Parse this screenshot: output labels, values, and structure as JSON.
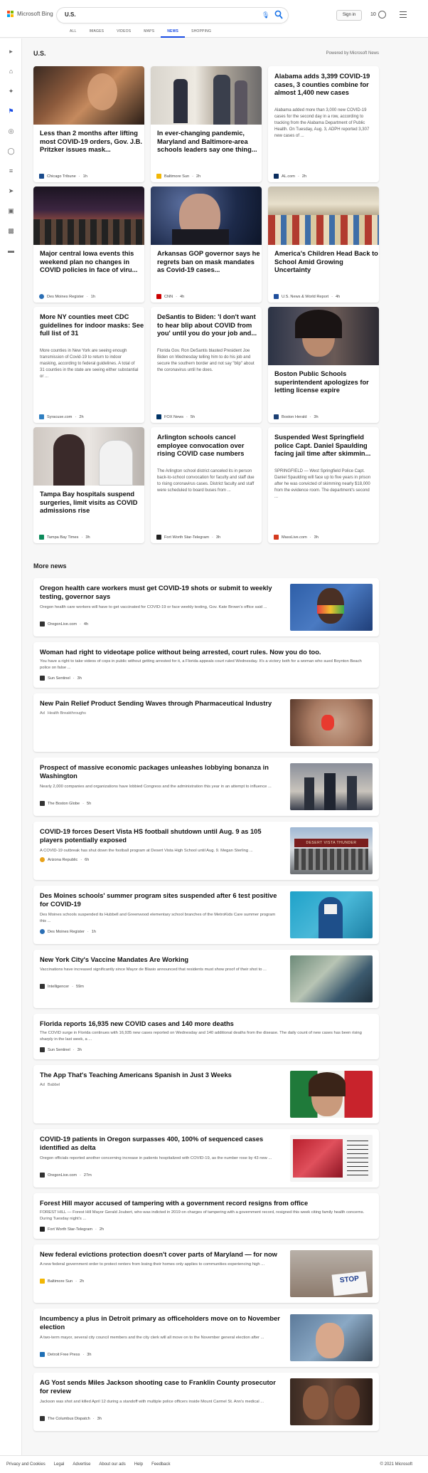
{
  "header": {
    "logo_text": "Microsoft Bing",
    "search_value": "U.S.",
    "signin": "Sign in",
    "rewards_points": "10",
    "tabs": [
      "ALL",
      "IMAGES",
      "VIDEOS",
      "MAPS",
      "NEWS",
      "SHOPPING"
    ],
    "active_tab": "NEWS"
  },
  "section": {
    "title": "U.S.",
    "powered_by": "Powered by Microsoft News"
  },
  "top_cards": [
    {
      "title": "Less than 2 months after lifting most COVID-19 orders, Gov. J.B. Pritzker issues mask...",
      "snippet": "",
      "source": "Chicago Tribune",
      "time": "1h",
      "logo_color": "#1a4b8c"
    },
    {
      "title": "In ever-changing pandemic, Maryland and Baltimore-area schools leaders say one thing...",
      "snippet": "",
      "source": "Baltimore Sun",
      "time": "2h",
      "logo_color": "#f2b705"
    },
    {
      "title": "Alabama adds 3,399 COVID-19 cases, 3 counties combine for almost 1,400 new cases",
      "snippet": "Alabama added more than 3,000 new COVID-19 cases for the second day in a row, according to tracking from the Alabama Department of Public Health. On Tuesday, Aug. 3, ADPH reported 3,307 new cases of ...",
      "source": "AL.com",
      "time": "2h",
      "logo_color": "#0a2d5e"
    },
    {
      "title": "Major central Iowa events this weekend plan no changes in COVID policies in face of viru...",
      "snippet": "",
      "source": "Des Moines Register",
      "time": "1h",
      "logo_color": "#2b6fb5"
    },
    {
      "title": "Arkansas GOP governor says he regrets ban on mask mandates as Covid-19 cases...",
      "snippet": "",
      "source": "CNN",
      "time": "4h",
      "logo_color": "#cc0000"
    },
    {
      "title": "America's Children Head Back to School Amid Growing Uncertainty",
      "snippet": "",
      "source": "U.S. News & World Report",
      "time": "4h",
      "logo_color": "#1f4e9c"
    },
    {
      "title": "More NY counties meet CDC guidelines for indoor masks: See full list of 31",
      "snippet": "More counties in New York are seeing enough transmission of Covid-19 to return to indoor masking, according to federal guidelines. A total of 31 counties in the state are seeing either substantial or ...",
      "source": "Syracuse.com",
      "time": "2h",
      "logo_color": "#2f7fc1"
    },
    {
      "title": "DeSantis to Biden: 'I don't want to hear blip about COVID from you' until you do your job and...",
      "snippet": "Florida Gov. Ron DeSantis blasted President Joe Biden on Wednesday telling him to do his job and secure the southern border and not say \"blip\" about the coronavirus until he does.",
      "source": "FOX News",
      "time": "5h",
      "logo_color": "#003366"
    },
    {
      "title": "Boston Public Schools superintendent apologizes for letting license expire",
      "snippet": "",
      "source": "Boston Herald",
      "time": "3h",
      "logo_color": "#1b3f73"
    },
    {
      "title": "Tampa Bay hospitals suspend surgeries, limit visits as COVID admissions rise",
      "snippet": "",
      "source": "Tampa Bay Times",
      "time": "3h",
      "logo_color": "#0c8a5b"
    },
    {
      "title": "Arlington schools cancel employee convocation over rising COVID case numbers",
      "snippet": "The Arlington school district canceled its in person back-to-school convocation for faculty and staff due to rising coronavirus cases. District faculty and staff were scheduled to board buses from ...",
      "source": "Fort Worth Star-Telegram",
      "time": "3h",
      "logo_color": "#222222"
    },
    {
      "title": "Suspended West Springfield police Capt. Daniel Spaulding facing jail time after skimmin...",
      "snippet": "SPRINGFIELD — West Springfield Police Capt. Daniel Spaulding will face up to five years in prison after he was convicted of skimming nearly $18,000 from the evidence room. The department's second ...",
      "source": "MassLive.com",
      "time": "3h",
      "logo_color": "#d43a1f"
    }
  ],
  "more_news_title": "More news",
  "more_news": [
    {
      "title": "Oregon health care workers must get COVID-19 shots or submit to weekly testing, governor says",
      "snippet": "Oregon health care workers will have to get vaccinated for COVID-19 or face weekly testing, Gov. Kate Brown's office said ...",
      "source": "OregonLive.com",
      "time": "4h",
      "ad": "",
      "logo_color": "#333333"
    },
    {
      "title": "Woman had right to videotape police without being arrested, court rules. Now you do too.",
      "snippet": "You have a right to take videos of cops in public without getting arrested for it, a Florida appeals court ruled Wednesday. It's a victory both for a woman who sued Boynton Beach police on false ...",
      "source": "Sun Sentinel",
      "time": "3h",
      "ad": "",
      "logo_color": "#333333"
    },
    {
      "title": "New Pain Relief Product Sending Waves through Pharmaceutical Industry",
      "snippet": "",
      "source": "Health Breakthroughs",
      "time": "",
      "ad": "Ad",
      "logo_color": ""
    },
    {
      "title": "Prospect of massive economic packages unleashes lobbying bonanza in Washington",
      "snippet": "Nearly 2,000 companies and organizations have lobbied Congress and the administration this year in an attempt to influence ...",
      "source": "The Boston Globe",
      "time": "5h",
      "ad": "",
      "logo_color": "#333333"
    },
    {
      "title": "COVID-19 forces Desert Vista HS football shutdown until Aug. 9 as 105 players potentially exposed",
      "snippet": "A COVID-19 outbreak has shut down the football program at Desert Vista High School until Aug. 9. Megan Sterling ...",
      "source": "Arizona Republic",
      "time": "6h",
      "ad": "",
      "logo_color": "#e8a21b"
    },
    {
      "title": "Des Moines schools' summer program sites suspended after 6 test positive for COVID-19",
      "snippet": "Des Moines schools suspended its Hubbell and Greenwood elementary school branches of the MetroKids Care summer program this ...",
      "source": "Des Moines Register",
      "time": "1h",
      "ad": "",
      "logo_color": "#2b6fb5"
    },
    {
      "title": "New York City's Vaccine Mandates Are Working",
      "snippet": "Vaccinations have increased significantly since Mayor de Blasio announced that residents must show proof of their shot to ...",
      "source": "Intelligencer",
      "time": "59m",
      "ad": "",
      "logo_color": "#333333"
    },
    {
      "title": "Florida reports 16,935 new COVID cases and 140 more deaths",
      "snippet": "The COVID surge in Florida continues with 16,935 new cases reported on Wednesday and 140 additional deaths from the disease. The daily count of new cases has been rising sharply in the last week, a ...",
      "source": "Sun Sentinel",
      "time": "3h",
      "ad": "",
      "logo_color": "#333333"
    },
    {
      "title": "The App That's Teaching Americans Spanish in Just 3 Weeks",
      "snippet": "",
      "source": "Babbel",
      "time": "",
      "ad": "Ad",
      "logo_color": ""
    },
    {
      "title": "COVID-19 patients in Oregon surpasses 400, 100% of sequenced cases identified as delta",
      "snippet": "Oregon officials reported another concerning increase in patients hospitalized with COVID-19, as the number rose by 43 new ...",
      "source": "OregonLive.com",
      "time": "27m",
      "ad": "",
      "logo_color": "#333333"
    },
    {
      "title": "Forest Hill mayor accused of tampering with a government record resigns from office",
      "snippet": "FOREST HILL — Forest Hill Mayor Gerald Joubert, who was indicted in 2019 on charges of tampering with a government record, resigned this week citing family health concerns. During Tuesday night's ...",
      "source": "Fort Worth Star-Telegram",
      "time": "2h",
      "ad": "",
      "logo_color": "#222222"
    },
    {
      "title": "New federal evictions protection doesn't cover parts of Maryland — for now",
      "snippet": "A new federal government order to protect renters from losing their homes only applies to communities experiencing high ...",
      "source": "Baltimore Sun",
      "time": "2h",
      "ad": "",
      "logo_color": "#f2b705"
    },
    {
      "title": "Incumbency a plus in Detroit primary as officeholders move on to November election",
      "snippet": "A two-term mayor, several city council members and the city clerk will all move on to the November general election after ...",
      "source": "Detroit Free Press",
      "time": "3h",
      "ad": "",
      "logo_color": "#1f6fb5"
    },
    {
      "title": "AG Yost sends Miles Jackson shooting case to Franklin County prosecutor for review",
      "snippet": "Jackson was shot and killed April 12 during a standoff with multiple police officers inside Mount Carmel St. Ann's medical ...",
      "source": "The Columbus Dispatch",
      "time": "3h",
      "ad": "",
      "logo_color": "#333333"
    }
  ],
  "image_text": {
    "stop_sign": "STOP",
    "thunder_banner": "DESERT VISTA THUNDER"
  },
  "footer": {
    "links": [
      "Privacy and Cookies",
      "Legal",
      "Advertise",
      "About our ads",
      "Help",
      "Feedback"
    ],
    "copyright": "© 2021 Microsoft"
  }
}
